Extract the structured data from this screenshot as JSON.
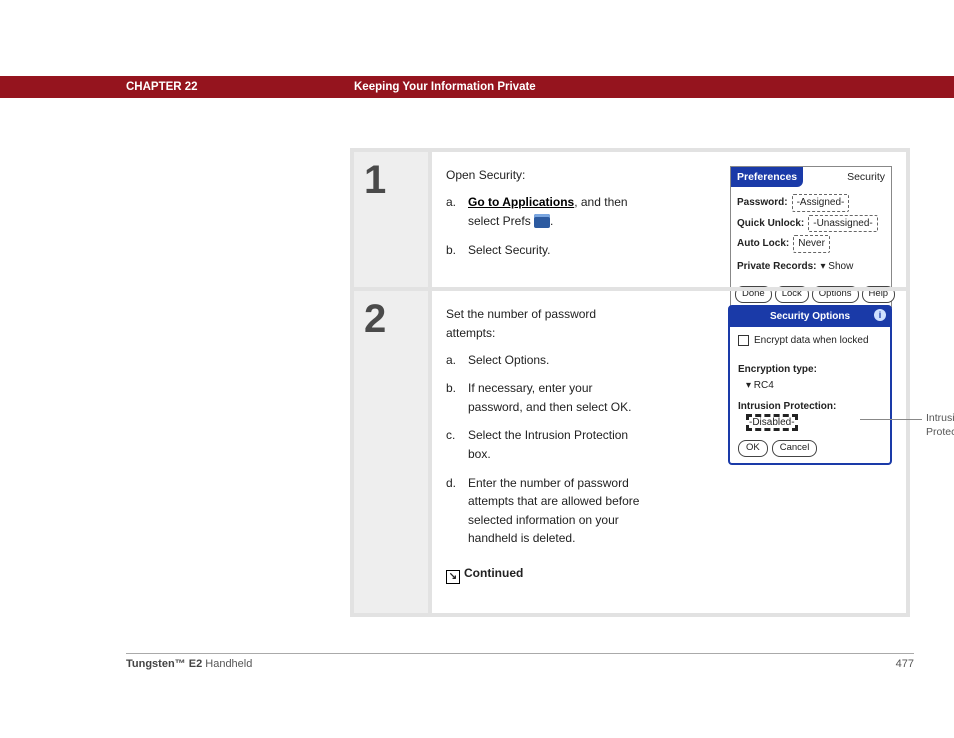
{
  "header": {
    "chapter": "CHAPTER 22",
    "title": "Keeping Your Information Private"
  },
  "steps": [
    {
      "num": "1",
      "intro": "Open Security:",
      "items": [
        {
          "letter": "a.",
          "pre": "",
          "link": "Go to Applications",
          "post": ", and then select Prefs ",
          "icon": true,
          "tail": "."
        },
        {
          "letter": "b.",
          "text": "Select Security."
        }
      ]
    },
    {
      "num": "2",
      "intro": "Set the number of password attempts:",
      "items": [
        {
          "letter": "a.",
          "text": "Select Options."
        },
        {
          "letter": "b.",
          "text": "If necessary, enter your password, and then select OK."
        },
        {
          "letter": "c.",
          "text": "Select the Intrusion Protection box."
        },
        {
          "letter": "d.",
          "text": "Enter the number of password attempts that are allowed before selected information on your handheld is deleted."
        }
      ],
      "continued": "Continued"
    }
  ],
  "palm_prefs": {
    "title_left": "Preferences",
    "title_right": "Security",
    "rows": [
      {
        "label": "Password:",
        "value": "-Assigned-",
        "type": "pill"
      },
      {
        "label": "Quick Unlock:",
        "value": "-Unassigned-",
        "type": "pill"
      },
      {
        "label": "Auto Lock:",
        "value": "Never",
        "type": "pill"
      },
      {
        "label": "Private Records:",
        "value": "▾ Show",
        "type": "plain"
      }
    ],
    "buttons": [
      "Done",
      "Lock",
      "Options",
      "Help"
    ]
  },
  "palm_sec": {
    "title": "Security Options",
    "checkbox": "Encrypt data when locked",
    "enc_label": "Encryption type:",
    "enc_value": "▾ RC4",
    "ip_label": "Intrusion Protection:",
    "ip_value": "-Disabled-",
    "buttons": [
      "OK",
      "Cancel"
    ],
    "callout": "Intrusion Protection box"
  },
  "footer": {
    "product_b": "Tungsten™ E2",
    "product_r": " Handheld",
    "page": "477"
  }
}
